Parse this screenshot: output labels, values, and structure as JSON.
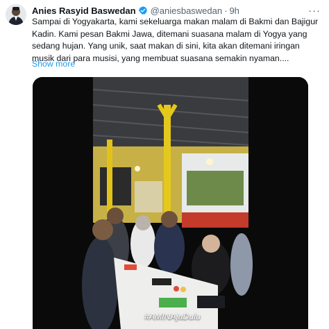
{
  "author": {
    "display_name": "Anies Rasyid Baswedan",
    "handle": "@aniesbaswedan",
    "separator": "·",
    "time": "9h",
    "verified_icon": "verified-badge-icon",
    "verified_color": "#1d9bf0"
  },
  "post": {
    "text_lines": [
      "Sampai di Yogyakarta, kami sekeluarga makan malam di Bakmi dan Bajigur",
      "Kadin. Kami pesan Bakmi Jawa, ditemani suasana malam di Yogya yang",
      "sedang hujan. Yang unik, saat makan di sini, kita akan ditemani iringan",
      "musik dari para musisi, yang membuat suasana semakin nyaman...."
    ],
    "show_more_label": "Show more",
    "more_icon": "more-options-icon"
  },
  "media": {
    "type": "video",
    "overlay_hashtag": "#AMINAjaDulu"
  },
  "colors": {
    "link": "#1d9bf0",
    "secondary_text": "#536471",
    "primary_text": "#0f1419"
  }
}
